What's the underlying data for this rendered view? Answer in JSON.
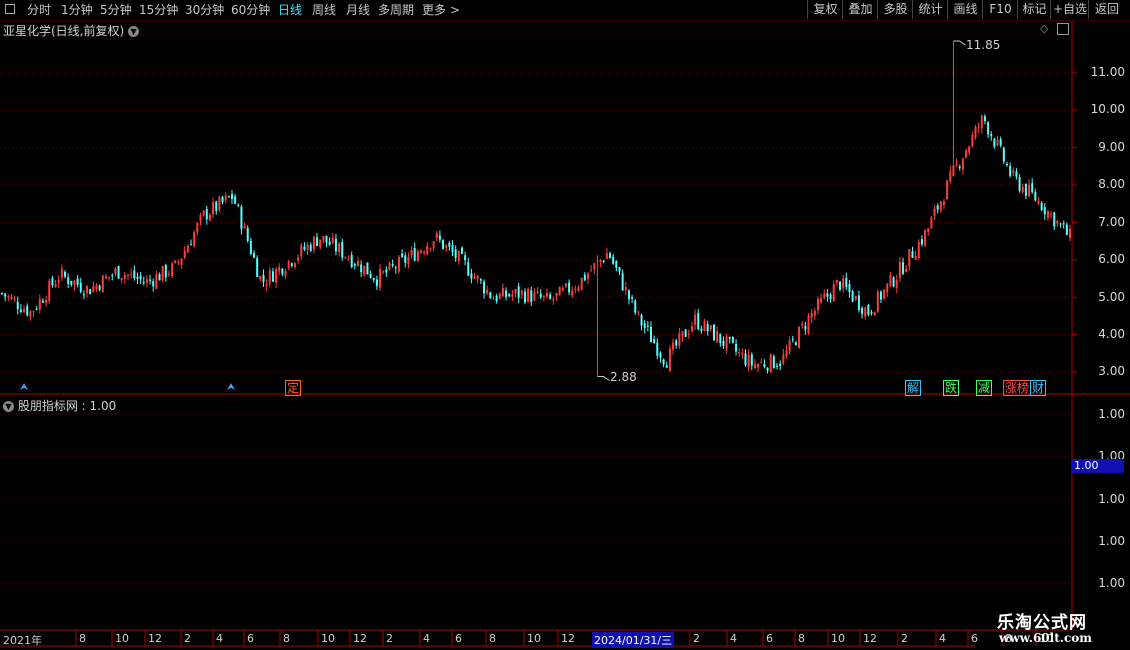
{
  "toolbar": {
    "sq_icon": "window-icon",
    "left": [
      {
        "label": "分时"
      },
      {
        "label": "1分钟"
      },
      {
        "label": "5分钟"
      },
      {
        "label": "15分钟"
      },
      {
        "label": "30分钟"
      },
      {
        "label": "60分钟"
      },
      {
        "label": "日线",
        "active": true
      },
      {
        "label": "周线"
      },
      {
        "label": "月线"
      },
      {
        "label": "多周期"
      },
      {
        "label": "更多 >"
      }
    ],
    "right": [
      {
        "label": "复权"
      },
      {
        "label": "叠加"
      },
      {
        "label": "多股"
      },
      {
        "label": "统计"
      },
      {
        "label": "画线"
      },
      {
        "label": "F10"
      },
      {
        "label": "标记"
      },
      {
        "label": "+自选"
      },
      {
        "label": "返回"
      }
    ]
  },
  "main_chart": {
    "title": "亚星化学(日线,前复权)",
    "high_label": "11.85",
    "low_label": "2.88",
    "y_ticks": [
      "11.00",
      "10.00",
      "9.00",
      "8.00",
      "7.00",
      "6.00",
      "5.00",
      "4.00",
      "3.00"
    ],
    "events": [
      {
        "text": "解",
        "color": "#3fc0ff"
      },
      {
        "text": "跌",
        "color": "#40ff60"
      },
      {
        "text": "减",
        "color": "#40ff60"
      },
      {
        "text": "涨榜",
        "color": "#ff5050"
      },
      {
        "text": "财",
        "color": "#3fc0ff"
      },
      {
        "text": "定",
        "color": "#ff6020"
      }
    ]
  },
  "indicator": {
    "title": "股朋指标网 : 1.00",
    "y_ticks": [
      "1.00",
      "1.00",
      "1.00",
      "1.00",
      "1.00"
    ],
    "current_value": "1.00"
  },
  "x_axis": {
    "start": "2021年",
    "cursor_date": "2024/01/31/三",
    "ticks": [
      "8",
      "10",
      "12",
      "2",
      "4",
      "6",
      "8",
      "10",
      "12",
      "2",
      "4",
      "6",
      "8",
      "10",
      "12",
      "2",
      "4",
      "6",
      "8",
      "10",
      "12",
      "2",
      "4",
      "6",
      "8",
      "10"
    ]
  },
  "watermark": {
    "title": "乐淘公式网",
    "url": "www.60lt.com"
  },
  "colors": {
    "up": "#ff3c3c",
    "down": "#54ffff",
    "grid": "#6a0000",
    "axis": "#b00000"
  },
  "chart_data": {
    "type": "candlestick",
    "title": "亚星化学(日线,前复权)",
    "x_range": [
      "2021-06",
      "2024-12"
    ],
    "y_range": [
      2.6,
      12.0
    ],
    "anchor_prices": [
      {
        "date": "2021-06",
        "price": 5.1
      },
      {
        "date": "2021-07",
        "price": 4.6
      },
      {
        "date": "2021-09",
        "price": 5.6
      },
      {
        "date": "2021-10",
        "price": 5.2
      },
      {
        "date": "2021-12",
        "price": 5.7
      },
      {
        "date": "2022-01",
        "price": 5.4
      },
      {
        "date": "2022-02",
        "price": 5.8
      },
      {
        "date": "2022-03",
        "price": 7.2
      },
      {
        "date": "2022-04",
        "price": 7.7
      },
      {
        "date": "2022-05",
        "price": 5.4
      },
      {
        "date": "2022-06",
        "price": 6.0
      },
      {
        "date": "2022-07",
        "price": 6.6
      },
      {
        "date": "2022-08",
        "price": 6.1
      },
      {
        "date": "2022-09",
        "price": 5.5
      },
      {
        "date": "2022-11",
        "price": 6.0
      },
      {
        "date": "2022-12",
        "price": 6.6
      },
      {
        "date": "2023-01",
        "price": 5.9
      },
      {
        "date": "2023-02",
        "price": 5.0
      },
      {
        "date": "2023-04",
        "price": 5.1
      },
      {
        "date": "2023-05",
        "price": 4.9
      },
      {
        "date": "2023-07",
        "price": 5.4
      },
      {
        "date": "2023-08",
        "price": 6.2
      },
      {
        "date": "2023-09",
        "price": 4.5
      },
      {
        "date": "2023-10",
        "price": 3.3
      },
      {
        "date": "2023-11",
        "price": 4.4
      },
      {
        "date": "2023-12",
        "price": 3.8
      },
      {
        "date": "2024-01",
        "price": 3.2
      },
      {
        "date": "2024-02",
        "price": 3.3
      },
      {
        "date": "2024-03",
        "price": 4.5
      },
      {
        "date": "2024-04",
        "price": 5.4
      },
      {
        "date": "2024-05",
        "price": 4.6
      },
      {
        "date": "2024-06",
        "price": 5.6
      },
      {
        "date": "2024-07",
        "price": 6.7
      },
      {
        "date": "2024-08",
        "price": 8.4
      },
      {
        "date": "2024-09",
        "price": 9.8
      },
      {
        "date": "2024-10",
        "price": 8.2
      },
      {
        "date": "2024-11",
        "price": 7.5
      },
      {
        "date": "2024-12",
        "price": 6.6
      }
    ],
    "high": {
      "label": "11.85",
      "value": 11.85
    },
    "low": {
      "label": "2.88",
      "value": 2.88
    }
  }
}
